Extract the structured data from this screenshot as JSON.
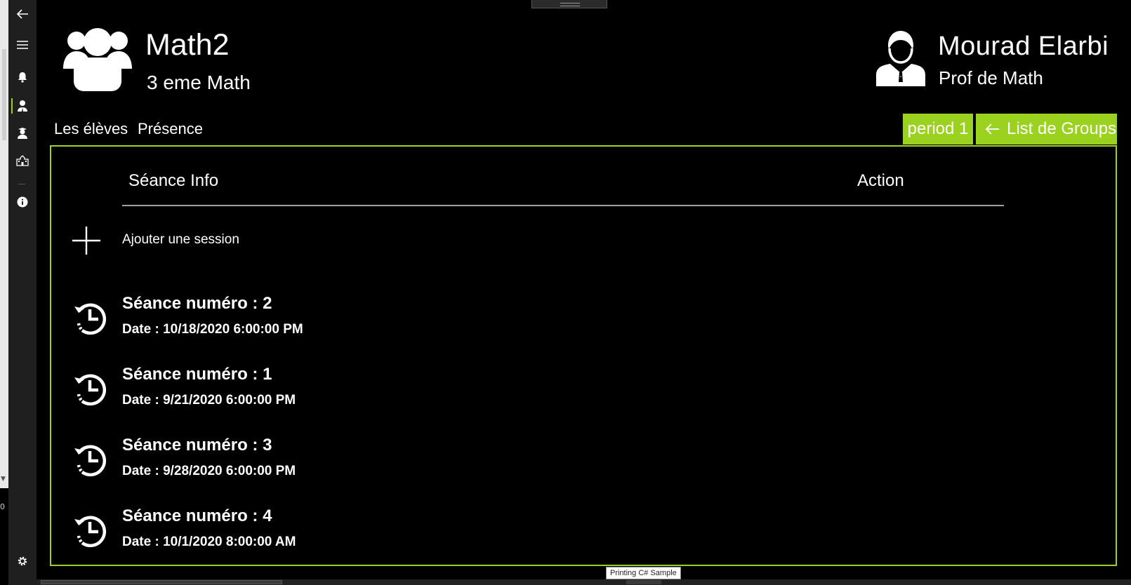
{
  "header": {
    "group_name": "Math2",
    "group_class": "3 eme Math",
    "prof_name": "Mourad Elarbi",
    "prof_role": "Prof de  Math"
  },
  "tabs": [
    {
      "label": "Les élèves"
    },
    {
      "label": "Présence"
    }
  ],
  "buttons": {
    "period_label": "period 1",
    "groups_label": "List de Groups"
  },
  "table": {
    "col_info": "Séance Info",
    "col_action": "Action",
    "add_label": "Ajouter une session",
    "sessions": [
      {
        "title": "Séance numéro : 2",
        "date": "Date : 10/18/2020 6:00:00 PM"
      },
      {
        "title": "Séance numéro : 1",
        "date": "Date : 9/21/2020 6:00:00 PM"
      },
      {
        "title": "Séance numéro : 3",
        "date": "Date : 9/28/2020 6:00:00 PM"
      },
      {
        "title": "Séance numéro : 4",
        "date": "Date : 10/1/2020 8:00:00 AM"
      }
    ]
  },
  "tooltip": "Printing C# Sample",
  "left_number": "0",
  "nav": {
    "icons": [
      "back-arrow-icon",
      "hamburger-menu-icon",
      "bell-icon",
      "teacher-icon",
      "student-icon",
      "school-building-icon",
      "info-icon",
      "settings-gear-icon"
    ]
  },
  "colors": {
    "accent": "#9ad21f",
    "background": "#000000",
    "nav_background": "#1f1f1f",
    "text": "#ffffff"
  }
}
